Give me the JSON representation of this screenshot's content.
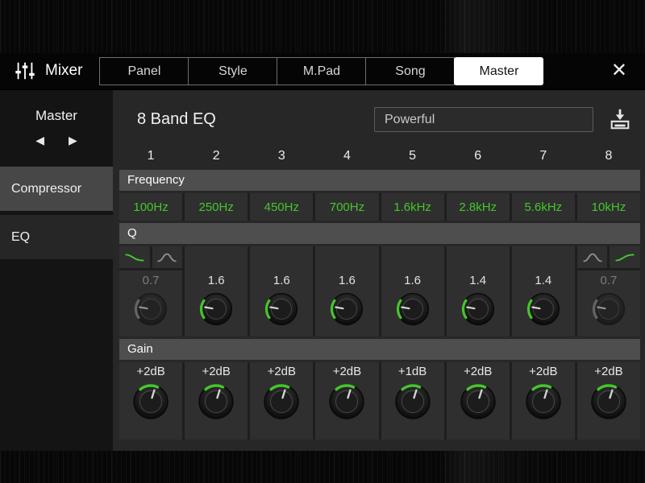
{
  "colors": {
    "accent_green": "#45c62c",
    "dim_gray": "#7b7b7b"
  },
  "header": {
    "app_title": "Mixer",
    "tabs": [
      {
        "label": "Panel",
        "selected": false
      },
      {
        "label": "Style",
        "selected": false
      },
      {
        "label": "M.Pad",
        "selected": false
      },
      {
        "label": "Song",
        "selected": false
      },
      {
        "label": "Master",
        "selected": true
      }
    ],
    "close_icon": "✕"
  },
  "sidebar": {
    "title": "Master",
    "prev_icon": "◀",
    "next_icon": "▶",
    "items": [
      {
        "label": "Compressor",
        "selected": false
      },
      {
        "label": "EQ",
        "selected": true
      }
    ]
  },
  "eq": {
    "title": "8 Band EQ",
    "preset_name": "Powerful",
    "sections": {
      "frequency": "Frequency",
      "q": "Q",
      "gain": "Gain"
    },
    "bands": [
      {
        "number": "1",
        "frequency": "100Hz",
        "q": "0.7",
        "gain": "+2dB",
        "type": "low-shelf"
      },
      {
        "number": "2",
        "frequency": "250Hz",
        "q": "1.6",
        "gain": "+2dB",
        "type": "peak"
      },
      {
        "number": "3",
        "frequency": "450Hz",
        "q": "1.6",
        "gain": "+2dB",
        "type": "peak"
      },
      {
        "number": "4",
        "frequency": "700Hz",
        "q": "1.6",
        "gain": "+2dB",
        "type": "peak"
      },
      {
        "number": "5",
        "frequency": "1.6kHz",
        "q": "1.6",
        "gain": "+1dB",
        "type": "peak"
      },
      {
        "number": "6",
        "frequency": "2.8kHz",
        "q": "1.4",
        "gain": "+2dB",
        "type": "peak"
      },
      {
        "number": "7",
        "frequency": "5.6kHz",
        "q": "1.4",
        "gain": "+2dB",
        "type": "peak"
      },
      {
        "number": "8",
        "frequency": "10kHz",
        "q": "0.7",
        "gain": "+2dB",
        "type": "high-shelf"
      }
    ]
  }
}
